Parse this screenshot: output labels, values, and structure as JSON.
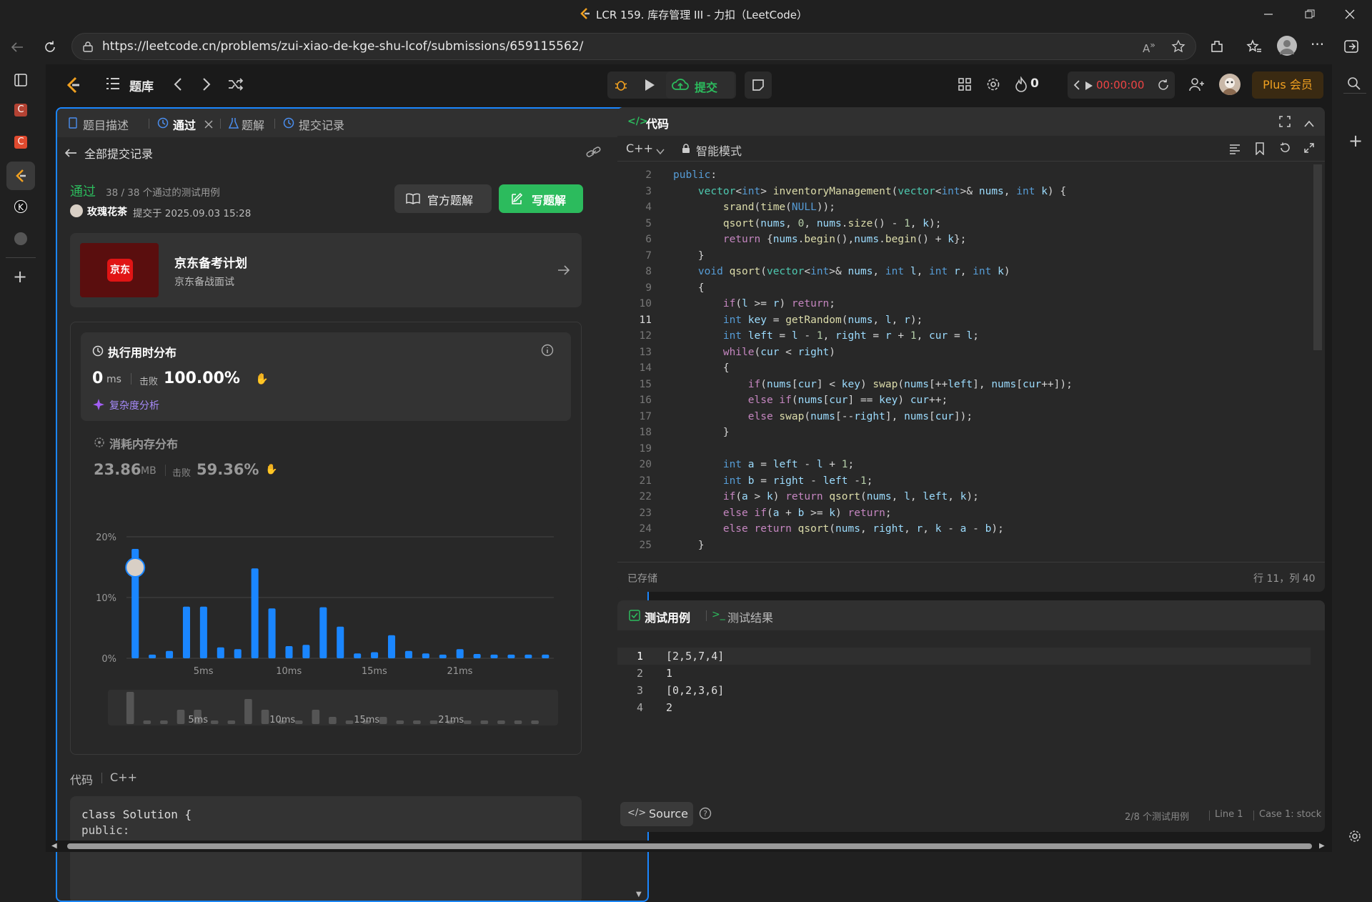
{
  "window": {
    "title": "LCR 159. 库存管理 III - 力扣（LeetCode）"
  },
  "browser": {
    "url": "https://leetcode.cn/problems/zui-xiao-de-kge-shu-lcof/submissions/659115562/"
  },
  "nav": {
    "problem_bank": "题库",
    "submit": "提交",
    "streak": "0",
    "timer": "00:00:00",
    "plus": "Plus 会员"
  },
  "left_tabs": [
    "题目描述",
    "通过",
    "题解",
    "提交记录"
  ],
  "back": {
    "label": "全部提交记录"
  },
  "result": {
    "status": "通过",
    "cases": "38 / 38 个通过的测试用例",
    "user": "玫瑰花茶",
    "submitted": "提交于 2025.09.03 15:28",
    "btn_official": "官方题解",
    "btn_write": "写题解"
  },
  "promo": {
    "logo": "京东",
    "title": "京东备考计划",
    "subtitle": "京东备战面试"
  },
  "runtime": {
    "title": "执行用时分布",
    "value": "0",
    "unit": "ms",
    "beats_label": "击败",
    "beats": "100.00%",
    "complexity": "复杂度分析"
  },
  "memory": {
    "title": "消耗内存分布",
    "value": "23.86",
    "unit": "MB",
    "beats_label": "击败",
    "beats": "59.36%"
  },
  "chart_data": {
    "type": "bar",
    "yticks": [
      "20%",
      "10%",
      "0%"
    ],
    "xticks": [
      "5ms",
      "10ms",
      "15ms",
      "21ms"
    ],
    "ylim": [
      0,
      20
    ],
    "values": [
      18,
      0.6,
      1.2,
      8.5,
      8.5,
      1.8,
      1.5,
      14.8,
      8.2,
      2,
      2.2,
      8.4,
      5.2,
      0.8,
      1,
      3.8,
      1.2,
      0.8,
      0.6,
      1.5,
      0.7,
      0.6,
      0.6,
      0.6,
      0.6
    ],
    "mini_values": [
      9,
      1,
      1,
      4,
      4,
      1,
      1,
      7,
      4,
      1,
      1,
      4,
      2,
      1,
      1,
      2,
      1,
      1,
      1,
      1,
      1,
      1,
      1,
      1,
      1
    ],
    "mini_xticks": [
      "5ms",
      "10ms",
      "15ms",
      "21ms"
    ]
  },
  "bottom_code": {
    "label": "代码",
    "lang": "C++",
    "line1": "class Solution {",
    "line2": "public:"
  },
  "editor": {
    "title": "代码",
    "lang": "C++",
    "mode": "智能模式",
    "saved": "已存储",
    "cursor": "行 11，列 40",
    "lines": [
      {
        "n": "2",
        "t": "public:"
      },
      {
        "n": "3",
        "t": "    vector<int> inventoryManagement(vector<int>& nums, int k) {"
      },
      {
        "n": "4",
        "t": "        srand(time(NULL));"
      },
      {
        "n": "5",
        "t": "        qsort(nums, 0, nums.size() - 1, k);"
      },
      {
        "n": "6",
        "t": "        return {nums.begin(),nums.begin() + k};"
      },
      {
        "n": "7",
        "t": "    }"
      },
      {
        "n": "8",
        "t": "    void qsort(vector<int>& nums, int l, int r, int k)"
      },
      {
        "n": "9",
        "t": "    {"
      },
      {
        "n": "10",
        "t": "        if(l >= r) return;"
      },
      {
        "n": "11",
        "t": "        int key = getRandom(nums, l, r);"
      },
      {
        "n": "12",
        "t": "        int left = l - 1, right = r + 1, cur = l;"
      },
      {
        "n": "13",
        "t": "        while(cur < right)"
      },
      {
        "n": "14",
        "t": "        {"
      },
      {
        "n": "15",
        "t": "            if(nums[cur] < key) swap(nums[++left], nums[cur++]);"
      },
      {
        "n": "16",
        "t": "            else if(nums[cur] == key) cur++;"
      },
      {
        "n": "17",
        "t": "            else swap(nums[--right], nums[cur]);"
      },
      {
        "n": "18",
        "t": "        }"
      },
      {
        "n": "19",
        "t": ""
      },
      {
        "n": "20",
        "t": "        int a = left - l + 1;"
      },
      {
        "n": "21",
        "t": "        int b = right - left -1;"
      },
      {
        "n": "22",
        "t": "        if(a > k) return qsort(nums, l, left, k);"
      },
      {
        "n": "23",
        "t": "        else if(a + b >= k) return;"
      },
      {
        "n": "24",
        "t": "        else return qsort(nums, right, r, k - a - b);"
      },
      {
        "n": "25",
        "t": "    }"
      }
    ]
  },
  "tests": {
    "tab_cases": "测试用例",
    "tab_result": "测试结果",
    "lines": [
      {
        "n": "1",
        "t": "[2,5,7,4]"
      },
      {
        "n": "2",
        "t": "1"
      },
      {
        "n": "3",
        "t": "[0,2,3,6]"
      },
      {
        "n": "4",
        "t": "2"
      }
    ],
    "source": "Source",
    "count": "2/8 个测试用例",
    "line": "Line 1",
    "case": "Case 1: stock"
  }
}
